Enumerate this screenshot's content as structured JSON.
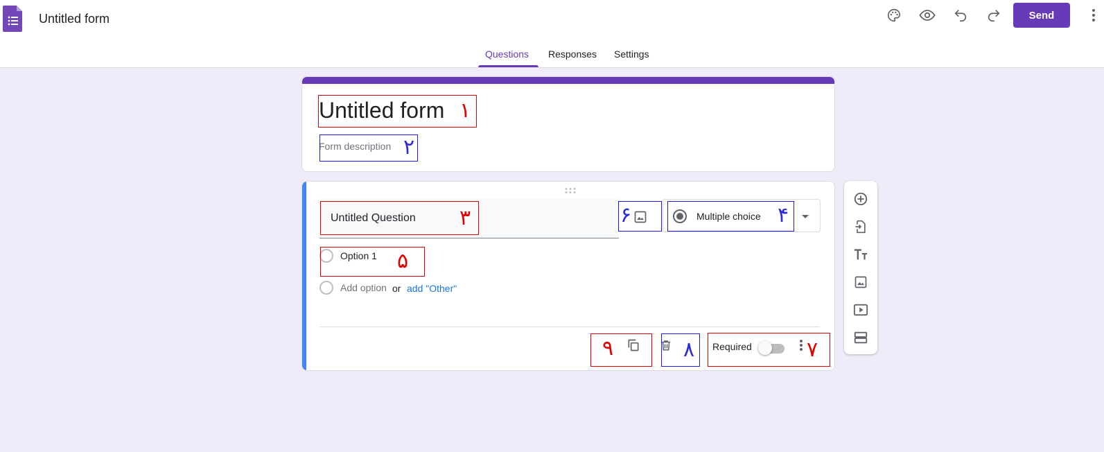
{
  "header": {
    "doc_title": "Untitled form",
    "send_label": "Send",
    "icons": [
      "palette-icon",
      "preview-eye-icon",
      "undo-icon",
      "redo-icon",
      "more-vert-icon"
    ]
  },
  "tabs": [
    {
      "label": "Questions",
      "active": true
    },
    {
      "label": "Responses",
      "active": false
    },
    {
      "label": "Settings",
      "active": false
    }
  ],
  "form": {
    "title": "Untitled form",
    "description": "Form description"
  },
  "question": {
    "title": "Untitled Question",
    "type": "Multiple choice",
    "options": [
      "Option 1"
    ],
    "add_option_label": "Add option",
    "or_label": "or",
    "add_other_label": "add \"Other\"",
    "required_label": "Required",
    "required": false
  },
  "annotations": [
    "١",
    "٢",
    "٣",
    "۴",
    "۵",
    "۶",
    "٧",
    "٨",
    "٩"
  ],
  "colors": {
    "accent": "#673ab7",
    "background": "#f0ebf8",
    "active_question_bar": "#4285f4",
    "link": "#1a73e8"
  }
}
